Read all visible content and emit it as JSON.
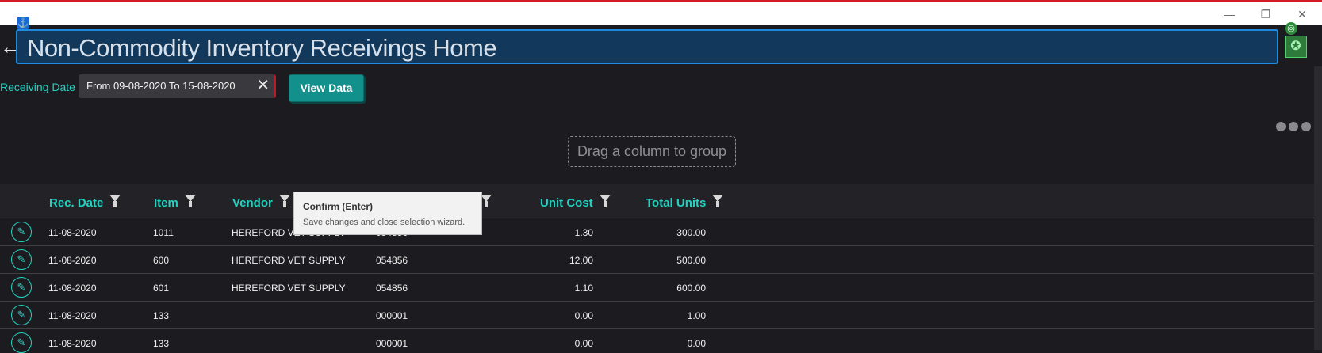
{
  "window": {
    "minimize_glyph": "—",
    "restore_glyph": "❐",
    "close_glyph": "✕"
  },
  "header": {
    "back_glyph": "←",
    "title": "Non-Commodity Inventory Receivings Home"
  },
  "filters": {
    "receiving_date_label": "Receiving Date",
    "date_range_value": "From 09-08-2020 To 15-08-2020",
    "clear_glyph": "✕",
    "view_button_label": "View Data"
  },
  "grid": {
    "group_panel_text": "Drag a column to group",
    "columns": [
      "Rec. Date",
      "Item",
      "Vendor",
      "",
      "Unit Cost",
      "Total Units"
    ],
    "rows": [
      {
        "rec_date": "11-08-2020",
        "item": "1011",
        "vendor": "HEREFORD VET SUPPLY",
        "ref": "054856",
        "unit_cost": "1.30",
        "total_units": "300.00"
      },
      {
        "rec_date": "11-08-2020",
        "item": "600",
        "vendor": "HEREFORD VET SUPPLY",
        "ref": "054856",
        "unit_cost": "12.00",
        "total_units": "500.00"
      },
      {
        "rec_date": "11-08-2020",
        "item": "601",
        "vendor": "HEREFORD VET SUPPLY",
        "ref": "054856",
        "unit_cost": "1.10",
        "total_units": "600.00"
      },
      {
        "rec_date": "11-08-2020",
        "item": "133",
        "vendor": "",
        "ref": "000001",
        "unit_cost": "0.00",
        "total_units": "1.00"
      },
      {
        "rec_date": "11-08-2020",
        "item": "133",
        "vendor": "",
        "ref": "000001",
        "unit_cost": "0.00",
        "total_units": "0.00"
      }
    ]
  },
  "tooltip": {
    "title": "Confirm (Enter)",
    "description": "Save changes and close selection wizard."
  },
  "icons": {
    "edit": "pencil-icon",
    "filter": "funnel-icon",
    "anchor": "anchor-icon",
    "overflow": "more-dots-icon"
  },
  "colors": {
    "accent": "#22d3c2",
    "title_bg": "#12385c",
    "title_border": "#1f8ae0",
    "button_bg": "#12908c",
    "background": "#1c1c20"
  }
}
